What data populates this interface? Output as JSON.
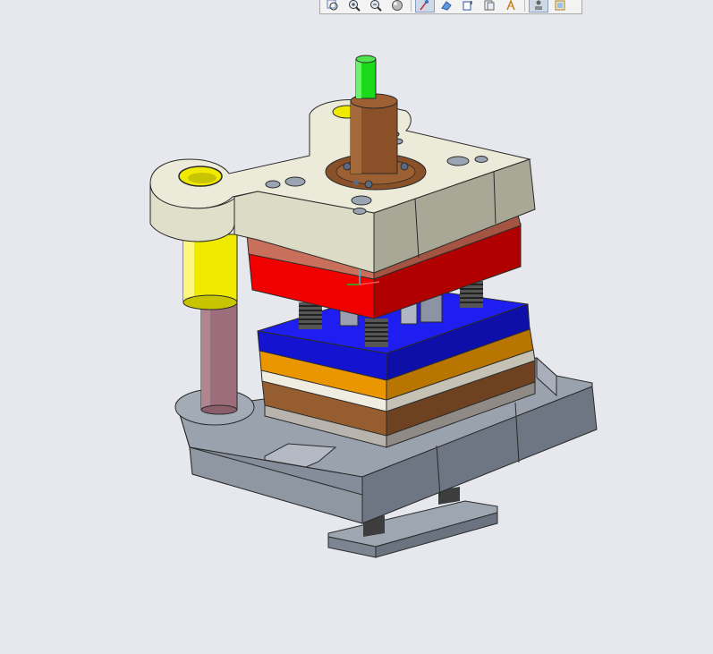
{
  "viewport": {
    "background": "#e6e8ed"
  },
  "toolbar": {
    "buttons": [
      {
        "icon": "zoom-window-icon",
        "active": false
      },
      {
        "icon": "zoom-in-icon",
        "active": false
      },
      {
        "icon": "zoom-out-icon",
        "active": false
      },
      {
        "icon": "shading-icon",
        "active": false
      },
      {
        "icon": "spin-center-icon",
        "active": true
      },
      {
        "icon": "saved-views-icon",
        "active": false
      },
      {
        "icon": "orient-icon",
        "active": false
      },
      {
        "icon": "layers-icon",
        "active": false
      },
      {
        "icon": "datum-display-icon",
        "active": false
      },
      {
        "icon": "display-style-icon",
        "active": true
      },
      {
        "icon": "appearance-icon",
        "active": false
      }
    ]
  },
  "model": {
    "parts": [
      {
        "name": "punch-shank",
        "color": "#1bd91b"
      },
      {
        "name": "shank-body",
        "color": "#8a5128"
      },
      {
        "name": "top-die-plate",
        "color": "#ecebd9"
      },
      {
        "name": "guide-bushing",
        "color": "#f0ea00"
      },
      {
        "name": "backing-plate",
        "color": "#c8705c"
      },
      {
        "name": "punch-holder-plate",
        "color": "#f00000"
      },
      {
        "name": "stripper-plate",
        "color": "#1414e6"
      },
      {
        "name": "die-plate",
        "color": "#ea9600"
      },
      {
        "name": "spacer-plate",
        "color": "#efece0"
      },
      {
        "name": "die-backing-plate",
        "color": "#955d30"
      },
      {
        "name": "die-shoe-plate",
        "color": "#b8b3ad"
      },
      {
        "name": "guide-pillar",
        "color": "#9c6e7c"
      },
      {
        "name": "bottom-base",
        "color": "#949ca9"
      }
    ]
  }
}
